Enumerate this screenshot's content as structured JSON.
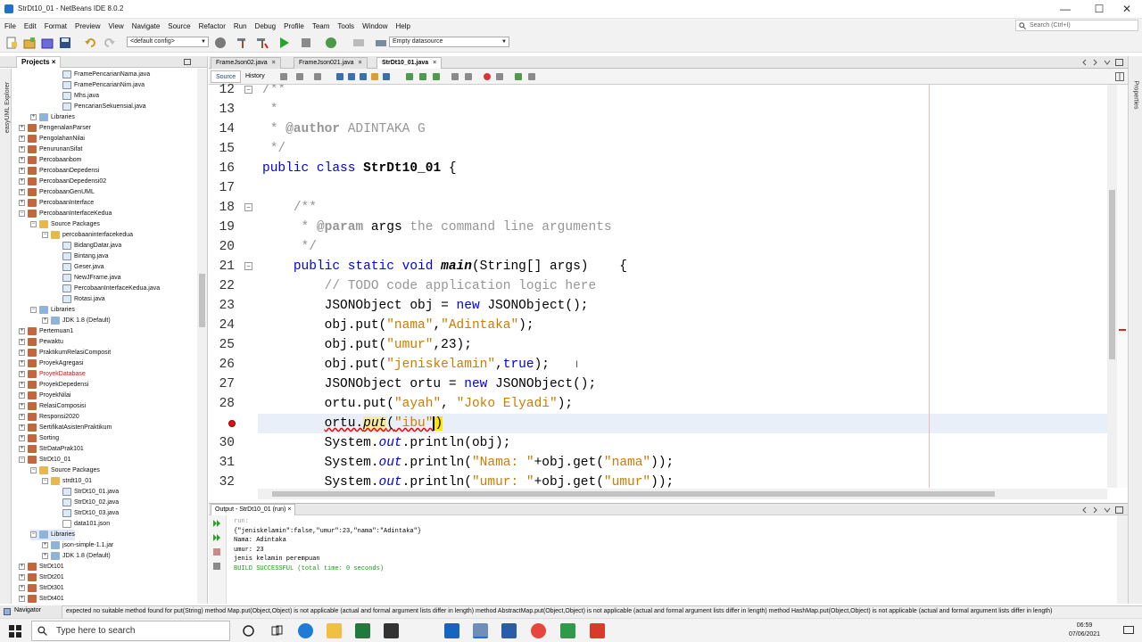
{
  "window": {
    "title": "StrDt10_01 - NetBeans IDE 8.0.2",
    "minimize": "—",
    "maximize": "☐",
    "close": "✕"
  },
  "menu": [
    "File",
    "Edit",
    "Format",
    "Preview",
    "View",
    "Navigate",
    "Source",
    "Refactor",
    "Run",
    "Debug",
    "Profile",
    "Team",
    "Tools",
    "Window",
    "Help"
  ],
  "search": {
    "placeholder": "Search (Ctrl+I)"
  },
  "toolbar": {
    "config": "<default config>",
    "datasource": "Empty datasource"
  },
  "left_panel": {
    "tab": "Projects",
    "close": "×",
    "navigator": "Navigator",
    "uml_strip": "easyUML Explorer",
    "tree": [
      {
        "label": "FramePencarianNama.java",
        "level": 4,
        "icon": "file",
        "exp": ""
      },
      {
        "label": "FramePencarianNim.java",
        "level": 4,
        "icon": "file",
        "exp": ""
      },
      {
        "label": "Mhs.java",
        "level": 4,
        "icon": "file",
        "exp": ""
      },
      {
        "label": "PencarianSekuensial.java",
        "level": 4,
        "icon": "file",
        "exp": ""
      },
      {
        "label": "Libraries",
        "level": 2,
        "icon": "lib",
        "exp": "+"
      },
      {
        "label": "PengenalanParser",
        "level": 1,
        "icon": "proj",
        "exp": "+"
      },
      {
        "label": "PengolahanNilai",
        "level": 1,
        "icon": "proj",
        "exp": "+"
      },
      {
        "label": "PenurunanSifat",
        "level": 1,
        "icon": "proj",
        "exp": "+"
      },
      {
        "label": "Percobaanbom",
        "level": 1,
        "icon": "proj",
        "exp": "+"
      },
      {
        "label": "PercobaanDepedensi",
        "level": 1,
        "icon": "proj",
        "exp": "+"
      },
      {
        "label": "PercobaanDepedensi02",
        "level": 1,
        "icon": "proj",
        "exp": "+"
      },
      {
        "label": "PercobaanGenUML",
        "level": 1,
        "icon": "proj",
        "exp": "+"
      },
      {
        "label": "PercobaanInterface",
        "level": 1,
        "icon": "proj",
        "exp": "+"
      },
      {
        "label": "PercobaanInterfaceKedua",
        "level": 1,
        "icon": "proj",
        "exp": "−"
      },
      {
        "label": "Source Packages",
        "level": 2,
        "icon": "pkg",
        "exp": "−"
      },
      {
        "label": "percobaaninterfacekedua",
        "level": 3,
        "icon": "pkg",
        "exp": "−"
      },
      {
        "label": "BidangDatar.java",
        "level": 4,
        "icon": "file",
        "exp": ""
      },
      {
        "label": "Bintang.java",
        "level": 4,
        "icon": "file",
        "exp": ""
      },
      {
        "label": "Geser.java",
        "level": 4,
        "icon": "file",
        "exp": ""
      },
      {
        "label": "NewJFrame.java",
        "level": 4,
        "icon": "file",
        "exp": ""
      },
      {
        "label": "PercobaanInterfaceKedua.java",
        "level": 4,
        "icon": "file",
        "exp": ""
      },
      {
        "label": "Rotasi.java",
        "level": 4,
        "icon": "file",
        "exp": ""
      },
      {
        "label": "Libraries",
        "level": 2,
        "icon": "lib",
        "exp": "−"
      },
      {
        "label": "JDK 1.8 (Default)",
        "level": 3,
        "icon": "lib",
        "exp": "+"
      },
      {
        "label": "Pertemuan1",
        "level": 1,
        "icon": "proj",
        "exp": "+"
      },
      {
        "label": "Pewaktu",
        "level": 1,
        "icon": "proj",
        "exp": "+"
      },
      {
        "label": "PraktikumRelasiComposit",
        "level": 1,
        "icon": "proj",
        "exp": "+"
      },
      {
        "label": "ProyekAgregasi",
        "level": 1,
        "icon": "proj",
        "exp": "+"
      },
      {
        "label": "ProyekDatabase",
        "level": 1,
        "icon": "proj",
        "exp": "+",
        "error": true
      },
      {
        "label": "ProyekDepedensi",
        "level": 1,
        "icon": "proj",
        "exp": "+"
      },
      {
        "label": "ProyekNilai",
        "level": 1,
        "icon": "proj",
        "exp": "+"
      },
      {
        "label": "RelasiComposisi",
        "level": 1,
        "icon": "proj",
        "exp": "+"
      },
      {
        "label": "Responsi2020",
        "level": 1,
        "icon": "proj",
        "exp": "+"
      },
      {
        "label": "SertifikatAsistenPraktikum",
        "level": 1,
        "icon": "proj",
        "exp": "+"
      },
      {
        "label": "Sorting",
        "level": 1,
        "icon": "proj",
        "exp": "+"
      },
      {
        "label": "StrDataPrak101",
        "level": 1,
        "icon": "proj",
        "exp": "+"
      },
      {
        "label": "StrDt10_01",
        "level": 1,
        "icon": "proj",
        "exp": "−"
      },
      {
        "label": "Source Packages",
        "level": 2,
        "icon": "pkg",
        "exp": "−"
      },
      {
        "label": "strdt10_01",
        "level": 3,
        "icon": "pkg",
        "exp": "−"
      },
      {
        "label": "StrDt10_01.java",
        "level": 4,
        "icon": "file",
        "exp": ""
      },
      {
        "label": "StrDt10_02.java",
        "level": 4,
        "icon": "file",
        "exp": ""
      },
      {
        "label": "StrDt10_03.java",
        "level": 4,
        "icon": "file",
        "exp": ""
      },
      {
        "label": "data101.json",
        "level": 4,
        "icon": "json",
        "exp": ""
      },
      {
        "label": "Libraries",
        "level": 2,
        "icon": "lib",
        "exp": "−",
        "selected": true
      },
      {
        "label": "json-simple-1.1.jar",
        "level": 3,
        "icon": "lib",
        "exp": "+"
      },
      {
        "label": "JDK 1.8 (Default)",
        "level": 3,
        "icon": "lib",
        "exp": "+"
      },
      {
        "label": "StrDt101",
        "level": 1,
        "icon": "proj",
        "exp": "+"
      },
      {
        "label": "StrDt201",
        "level": 1,
        "icon": "proj",
        "exp": "+"
      },
      {
        "label": "StrDt301",
        "level": 1,
        "icon": "proj",
        "exp": "+"
      },
      {
        "label": "StrDt401",
        "level": 1,
        "icon": "proj",
        "exp": "+"
      }
    ]
  },
  "editor": {
    "tabs": [
      {
        "label": "FrameJson02.java",
        "active": false
      },
      {
        "label": "FrameJson021.java",
        "active": false
      },
      {
        "label": "StrDt10_01.java",
        "active": true
      }
    ],
    "tab_close": "×",
    "subtabs": [
      "Source",
      "History"
    ],
    "line_numbers": [
      "12",
      "13",
      "14",
      "15",
      "16",
      "17",
      "18",
      "19",
      "20",
      "21",
      "22",
      "23",
      "24",
      "25",
      "26",
      "27",
      "28",
      "29",
      "30",
      "31",
      "32"
    ],
    "error_line": "29",
    "fold_glyph": "−",
    "text_cursor_glyph": "I"
  },
  "output": {
    "tab": "Output - StrDt10_01 (run)",
    "close": "×",
    "lines": [
      "run:",
      "{\"jeniskelamin\":false,\"umur\":23,\"nama\":\"Adintaka\"}",
      "Nama: Adintaka",
      "umur: 23",
      "jenis kelamin perempuan",
      "BUILD SUCCESSFUL (total time: 0 seconds)"
    ]
  },
  "status": {
    "message": "expected  no suitable method found for put(String)    method Map.put(Object,Object) is not applicable        (actual and formal argument lists differ in length)    method AbstractMap.put(Object,Object) is not applicable        (actual and formal argument lists differ in length)    method HashMap.put(Object,Object) is not applicable        (actual and formal argument lists differ in length)"
  },
  "taskbar": {
    "search": "Type here to search",
    "time": "06:59",
    "date": "07/06/2021"
  },
  "right_strip": "Properties",
  "colors": {
    "keyword": "#0000e6",
    "string": "#ce7b00",
    "comment": "#969696",
    "error": "#dd1111",
    "current_line": "#e9eff8"
  }
}
